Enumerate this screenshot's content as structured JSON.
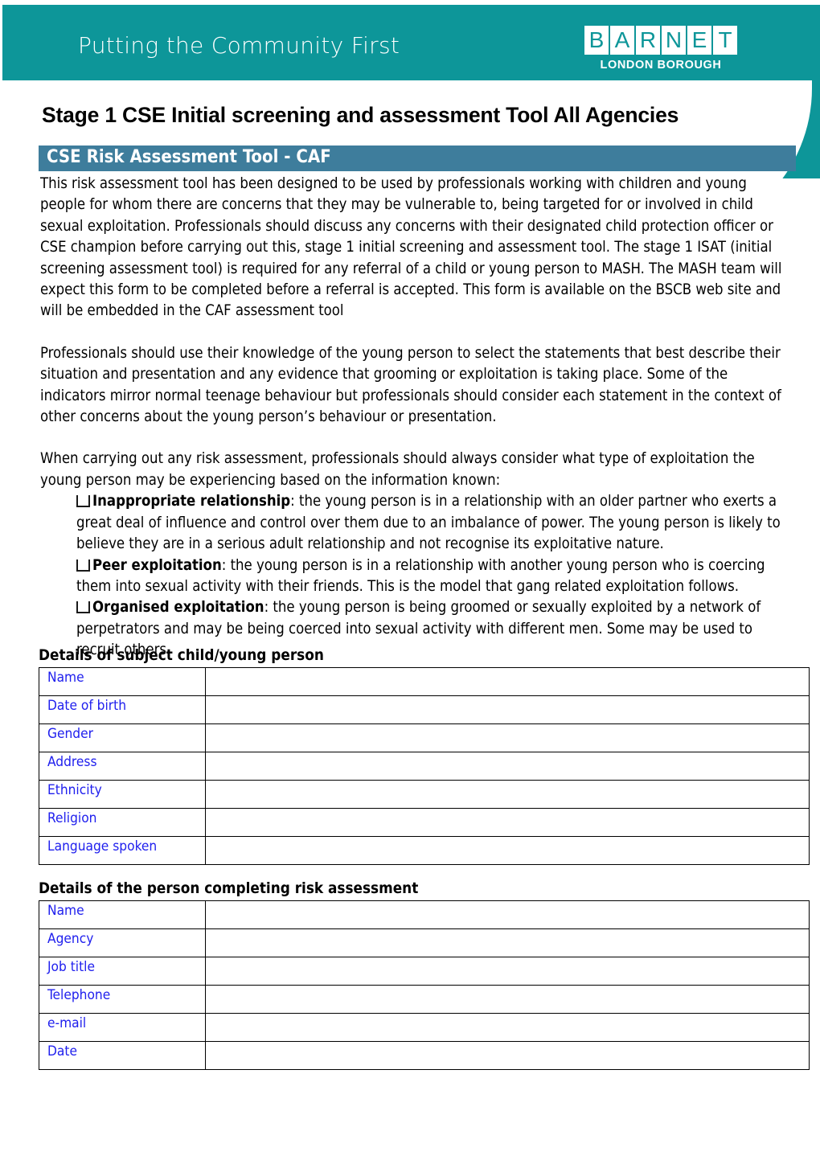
{
  "header": {
    "tagline": "Putting the Community First",
    "logo": {
      "letters": [
        "B",
        "A",
        "R",
        "N",
        "E",
        "T"
      ],
      "subtitle": "LONDON BOROUGH"
    },
    "brand_teal": "#0d9699"
  },
  "document": {
    "title": "Stage 1 CSE Initial screening and assessment Tool All Agencies",
    "section_bar_label": "CSE Risk Assessment Tool - CAF",
    "section_bar_color": "#3e7d9c"
  },
  "body": {
    "paragraph_1": "This risk assessment tool has been designed to be used by professionals working with children and young people for whom there are concerns that they may be vulnerable to, being targeted for or involved in child sexual exploitation. Professionals should discuss any concerns with their designated child protection officer or CSE champion before carrying out this, stage 1 initial screening and assessment tool. The stage 1 ISAT (initial screening assessment tool) is required for any referral of a child or young person to MASH. The MASH team will expect this form to be completed before a referral is accepted. This form is available on the BSCB web site and will be embedded in the CAF assessment tool",
    "paragraph_2": "Professionals should use their knowledge of the young person to select the statements that best describe their situation and presentation and any evidence that grooming or exploitation is taking place. Some of the indicators mirror normal teenage behaviour but professionals should consider each statement in the context of other concerns about the young person’s behaviour or presentation.",
    "paragraph_3": "When carrying out any risk assessment, professionals should always consider what type of exploitation the young person may be experiencing based on the information known:",
    "bullets": [
      {
        "term": "Inappropriate relationship",
        "text": ": the young person is in a relationship with an older partner who exerts a great deal of influence and control over them due to an imbalance of power. The young person is likely to believe they are in a serious adult relationship and not recognise its exploitative nature."
      },
      {
        "term": "Peer exploitation",
        "text": ": the young person is in a relationship with another young person who is coercing them into sexual activity with their friends. This is the model that gang related exploitation follows."
      },
      {
        "term": "Organised exploitation",
        "text": ": the young person is being groomed or sexually exploited by a network of perpetrators and may be being coerced into sexual activity with different men. Some may be used to recruit others."
      }
    ]
  },
  "tables": [
    {
      "heading": "Details of subject child/young person",
      "label_color": "#2020ee",
      "rows": [
        {
          "label": "Name",
          "value": ""
        },
        {
          "label": "Date of birth",
          "value": ""
        },
        {
          "label": "Gender",
          "value": ""
        },
        {
          "label": "Address",
          "value": ""
        },
        {
          "label": "Ethnicity",
          "value": ""
        },
        {
          "label": "Religion",
          "value": ""
        },
        {
          "label": "Language spoken",
          "value": ""
        }
      ]
    },
    {
      "heading": "Details of the person completing risk assessment",
      "label_color": "#2020ee",
      "rows": [
        {
          "label": "Name",
          "value": ""
        },
        {
          "label": "Agency",
          "value": ""
        },
        {
          "label": "Job title",
          "value": ""
        },
        {
          "label": "Telephone",
          "value": ""
        },
        {
          "label": "e-mail",
          "value": ""
        },
        {
          "label": "Date",
          "value": ""
        }
      ]
    }
  ]
}
